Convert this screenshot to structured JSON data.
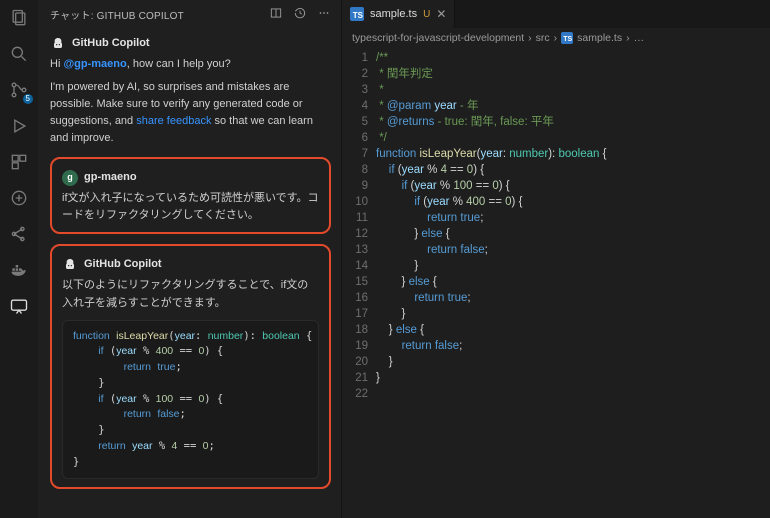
{
  "activity_bar": {
    "scm_badge": "5"
  },
  "chat": {
    "title": "チャット: GITHUB COPILOT",
    "messages": [
      {
        "id": "intro",
        "author": "GitHub Copilot",
        "avatar_kind": "copilot",
        "body_prefix": "Hi ",
        "mention": "@gp-maeno",
        "body_mid": ", how can I help you?",
        "para2_a": "I'm powered by AI, so surprises and mistakes are possible. Make sure to verify any generated code or suggestions, and ",
        "link": "share feedback",
        "para2_b": " so that we can learn and improve."
      },
      {
        "id": "user1",
        "author": "gp-maeno",
        "avatar_kind": "user",
        "initial": "g",
        "body": "if文が入れ子になっているため可読性が悪いです。コードをリファクタリングしてください。"
      },
      {
        "id": "copilot2",
        "author": "GitHub Copilot",
        "avatar_kind": "copilot",
        "body": "以下のようにリファクタリングすることで、if文の入れ子を減らすことができます。",
        "code": "function isLeapYear(year: number): boolean {\n    if (year % 400 == 0) {\n        return true;\n    }\n    if (year % 100 == 0) {\n        return false;\n    }\n    return year % 4 == 0;\n}"
      }
    ]
  },
  "editor": {
    "tab": {
      "filename": "sample.ts",
      "git_status": "U"
    },
    "breadcrumbs": {
      "seg1": "typescript-for-javascript-development",
      "seg2": "src",
      "seg3": "sample.ts",
      "more": "…"
    },
    "code_lines": [
      {
        "n": 1,
        "t": [
          [
            "c-cm",
            "/**"
          ]
        ]
      },
      {
        "n": 2,
        "t": [
          [
            "c-cm",
            " * 閏年判定"
          ]
        ]
      },
      {
        "n": 3,
        "t": [
          [
            "c-cm",
            " *"
          ]
        ]
      },
      {
        "n": 4,
        "t": [
          [
            "c-cm",
            " * "
          ],
          [
            "c-doc",
            "@param"
          ],
          [
            "c-cm",
            " "
          ],
          [
            "c-prm",
            "year"
          ],
          [
            "c-cm",
            " - 年"
          ]
        ]
      },
      {
        "n": 5,
        "t": [
          [
            "c-cm",
            " * "
          ],
          [
            "c-doc",
            "@returns"
          ],
          [
            "c-cm",
            " - true: 閏年, false: 平年"
          ]
        ]
      },
      {
        "n": 6,
        "t": [
          [
            "c-cm",
            " */"
          ]
        ]
      },
      {
        "n": 7,
        "t": [
          [
            "c-kw",
            "function"
          ],
          [
            "",
            " "
          ],
          [
            "c-fn",
            "isLeapYear"
          ],
          [
            "",
            "("
          ],
          [
            "c-prm",
            "year"
          ],
          [
            "",
            ": "
          ],
          [
            "c-type",
            "number"
          ],
          [
            "",
            ")"
          ],
          [
            "",
            ": "
          ],
          [
            "c-type",
            "boolean"
          ],
          [
            "",
            " {"
          ]
        ]
      },
      {
        "n": 8,
        "t": [
          [
            "",
            "    "
          ],
          [
            "c-kw",
            "if"
          ],
          [
            "",
            " ("
          ],
          [
            "c-prm",
            "year"
          ],
          [
            "",
            " % "
          ],
          [
            "c-num",
            "4"
          ],
          [
            "",
            " == "
          ],
          [
            "c-num",
            "0"
          ],
          [
            "",
            ") {"
          ]
        ]
      },
      {
        "n": 9,
        "t": [
          [
            "",
            "        "
          ],
          [
            "c-kw",
            "if"
          ],
          [
            "",
            " ("
          ],
          [
            "c-prm",
            "year"
          ],
          [
            "",
            " % "
          ],
          [
            "c-num",
            "100"
          ],
          [
            "",
            " == "
          ],
          [
            "c-num",
            "0"
          ],
          [
            "",
            ") {"
          ]
        ]
      },
      {
        "n": 10,
        "t": [
          [
            "",
            "            "
          ],
          [
            "c-kw",
            "if"
          ],
          [
            "",
            " ("
          ],
          [
            "c-prm",
            "year"
          ],
          [
            "",
            " % "
          ],
          [
            "c-num",
            "400"
          ],
          [
            "",
            " == "
          ],
          [
            "c-num",
            "0"
          ],
          [
            "",
            ") {"
          ]
        ]
      },
      {
        "n": 11,
        "t": [
          [
            "",
            "                "
          ],
          [
            "c-kw",
            "return"
          ],
          [
            "",
            " "
          ],
          [
            "c-const",
            "true"
          ],
          [
            "",
            ";"
          ]
        ]
      },
      {
        "n": 12,
        "t": [
          [
            "",
            "            } "
          ],
          [
            "c-kw",
            "else"
          ],
          [
            "",
            " {"
          ]
        ]
      },
      {
        "n": 13,
        "t": [
          [
            "",
            "                "
          ],
          [
            "c-kw",
            "return"
          ],
          [
            "",
            " "
          ],
          [
            "c-const",
            "false"
          ],
          [
            "",
            ";"
          ]
        ]
      },
      {
        "n": 14,
        "t": [
          [
            "",
            "            }"
          ]
        ]
      },
      {
        "n": 15,
        "t": [
          [
            "",
            "        } "
          ],
          [
            "c-kw",
            "else"
          ],
          [
            "",
            " {"
          ]
        ]
      },
      {
        "n": 16,
        "t": [
          [
            "",
            "            "
          ],
          [
            "c-kw",
            "return"
          ],
          [
            "",
            " "
          ],
          [
            "c-const",
            "true"
          ],
          [
            "",
            ";"
          ]
        ]
      },
      {
        "n": 17,
        "t": [
          [
            "",
            "        }"
          ]
        ]
      },
      {
        "n": 18,
        "t": [
          [
            "",
            "    } "
          ],
          [
            "c-kw",
            "else"
          ],
          [
            "",
            " {"
          ]
        ]
      },
      {
        "n": 19,
        "t": [
          [
            "",
            "        "
          ],
          [
            "c-kw",
            "return"
          ],
          [
            "",
            " "
          ],
          [
            "c-const",
            "false"
          ],
          [
            "",
            ";"
          ]
        ]
      },
      {
        "n": 20,
        "t": [
          [
            "",
            "    }"
          ]
        ]
      },
      {
        "n": 21,
        "t": [
          [
            "",
            "}"
          ]
        ]
      },
      {
        "n": 22,
        "t": [
          [
            "",
            ""
          ]
        ]
      }
    ]
  }
}
